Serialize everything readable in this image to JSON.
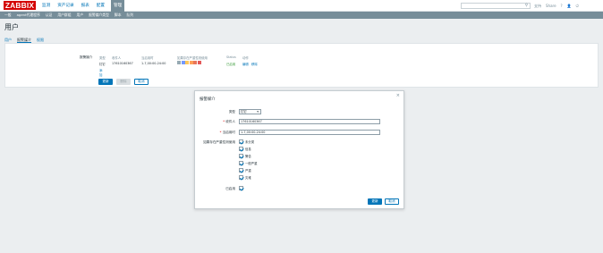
{
  "header": {
    "logo": "ZABBIX",
    "nav": [
      "监测",
      "资产记录",
      "报表",
      "配置",
      "管理"
    ],
    "active_nav_index": 4,
    "search_placeholder": "",
    "right_links": [
      "支持",
      "Share",
      "?",
      "用户",
      "退出"
    ]
  },
  "subnav": [
    "一般",
    "agent代理程序",
    "认证",
    "用户群组",
    "用户",
    "报警媒介类型",
    "脚本",
    "队列"
  ],
  "page": {
    "title": "用户",
    "tabs": [
      "用户",
      "报警媒介",
      "权限"
    ],
    "active_tab_index": 1
  },
  "media_form": {
    "label": "报警媒介",
    "headers": [
      "类型",
      "收件人",
      "当启用时",
      "如果存在严重性则使用",
      "Status",
      "动作"
    ],
    "row": {
      "type": "钉钉",
      "recipient": "17610160367",
      "when_active": "1-7,00:00-24:00",
      "status": "已启用",
      "action_edit": "编辑",
      "action_remove": "移除"
    },
    "add_link": "添加",
    "buttons": {
      "update": "更新",
      "delete": "删除",
      "cancel": "取消"
    }
  },
  "colors": {
    "accent": "#0275b8",
    "severities": [
      "#97aab3",
      "#7499ff",
      "#ffc859",
      "#ffa059",
      "#e97659",
      "#e45959"
    ]
  },
  "modal": {
    "title": "报警媒介",
    "close_icon": "×",
    "type_label": "类型",
    "type_value": "钉钉",
    "recipient_label": "收件人",
    "recipient_value": "17610160367",
    "when_label": "当启用时",
    "when_value": "1-7,00:00-24:00",
    "severity_label": "如果存在严重性则使用",
    "severities": [
      "未分类",
      "信息",
      "警告",
      "一般严重",
      "严重",
      "灾难"
    ],
    "enabled_label": "已启用",
    "buttons": {
      "update": "更新",
      "cancel": "取消"
    }
  }
}
